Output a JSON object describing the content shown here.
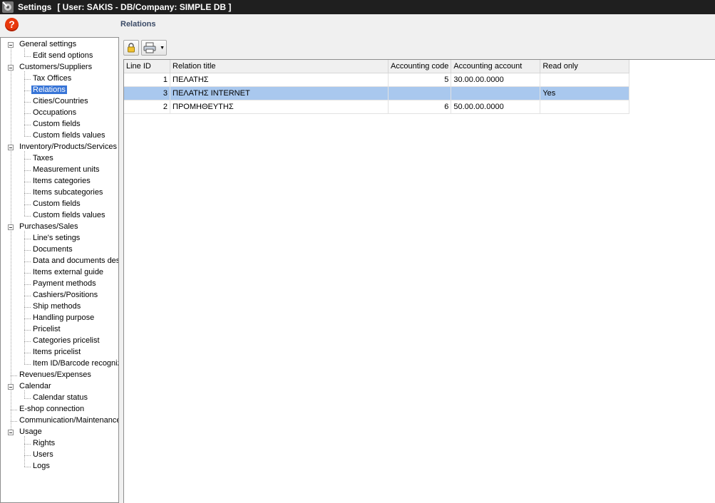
{
  "window": {
    "title": "Settings",
    "title_info": "[ User: SAKIS - DB/Company: SIMPLE DB ]"
  },
  "help": {
    "label": "?"
  },
  "page": {
    "section_title": "Relations"
  },
  "tree": {
    "items": [
      {
        "label": "General settings",
        "level": 0,
        "expanded": true
      },
      {
        "label": "Edit send options",
        "level": 1
      },
      {
        "label": "Customers/Suppliers",
        "level": 0,
        "expanded": true
      },
      {
        "label": "Tax Offices",
        "level": 1
      },
      {
        "label": "Relations",
        "level": 1,
        "selected": true
      },
      {
        "label": "Cities/Countries",
        "level": 1
      },
      {
        "label": "Occupations",
        "level": 1
      },
      {
        "label": "Custom fields",
        "level": 1
      },
      {
        "label": "Custom fields values",
        "level": 1
      },
      {
        "label": "Inventory/Products/Services",
        "level": 0,
        "expanded": true
      },
      {
        "label": "Taxes",
        "level": 1
      },
      {
        "label": "Measurement units",
        "level": 1
      },
      {
        "label": "Items categories",
        "level": 1
      },
      {
        "label": "Items subcategories",
        "level": 1
      },
      {
        "label": "Custom fields",
        "level": 1
      },
      {
        "label": "Custom fields values",
        "level": 1
      },
      {
        "label": "Purchases/Sales",
        "level": 0,
        "expanded": true
      },
      {
        "label": "Line's setings",
        "level": 1
      },
      {
        "label": "Documents",
        "level": 1
      },
      {
        "label": "Data and documents desi",
        "level": 1
      },
      {
        "label": "Items external guide",
        "level": 1
      },
      {
        "label": "Payment methods",
        "level": 1
      },
      {
        "label": "Cashiers/Positions",
        "level": 1
      },
      {
        "label": "Ship methods",
        "level": 1
      },
      {
        "label": "Handling purpose",
        "level": 1
      },
      {
        "label": "Pricelist",
        "level": 1
      },
      {
        "label": "Categories pricelist",
        "level": 1
      },
      {
        "label": "Items pricelist",
        "level": 1
      },
      {
        "label": "Item ID/Barcode recogniz",
        "level": 1
      },
      {
        "label": "Revenues/Expenses",
        "level": 0
      },
      {
        "label": "Calendar",
        "level": 0,
        "expanded": true
      },
      {
        "label": "Calendar status",
        "level": 1
      },
      {
        "label": "E-shop connection",
        "level": 0
      },
      {
        "label": "Communication/Maintenance",
        "level": 0
      },
      {
        "label": "Usage",
        "level": 0,
        "expanded": true
      },
      {
        "label": "Rights",
        "level": 1
      },
      {
        "label": "Users",
        "level": 1
      },
      {
        "label": "Logs",
        "level": 1
      }
    ]
  },
  "grid": {
    "columns": [
      "Line ID",
      "Relation title",
      "Accounting code",
      "Accounting account",
      "Read only"
    ],
    "rows": [
      {
        "line_id": "1",
        "title": "ΠΕΛΑΤΗΣ",
        "code": "5",
        "account": "30.00.00.0000",
        "read_only": "",
        "highlighted": false
      },
      {
        "line_id": "3",
        "title": "ΠΕΛΑΤΗΣ INTERNET",
        "code": "",
        "account": "",
        "read_only": "Yes",
        "highlighted": true
      },
      {
        "line_id": "2",
        "title": "ΠΡΟΜΗΘΕΥΤΗΣ",
        "code": "6",
        "account": "50.00.00.0000",
        "read_only": "",
        "highlighted": false
      }
    ]
  },
  "icons": {
    "app": "settings-gear-icon",
    "lock": "lock-icon",
    "print": "printer-icon",
    "dropdown": "chevron-down-icon"
  },
  "colors": {
    "titlebar": "#1f1f1f",
    "selection": "#3875d7",
    "row_highlight": "#a9c8ee",
    "help": "#e8380c"
  }
}
